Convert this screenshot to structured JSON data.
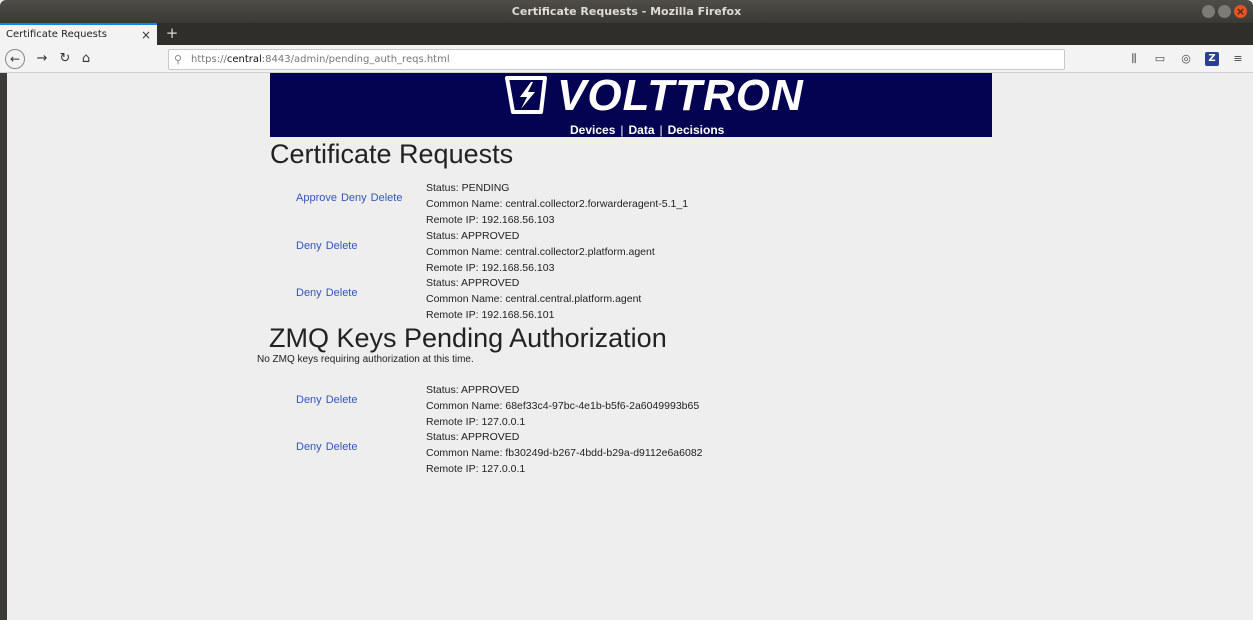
{
  "window": {
    "title": "Certificate Requests - Mozilla Firefox"
  },
  "tabs": [
    {
      "label": "Certificate Requests",
      "active": true
    }
  ],
  "urlbar": {
    "prefix": "https://",
    "host": "central",
    "rest": ":8443/admin/pending_auth_reqs.html"
  },
  "banner": {
    "brand": "VOLTTRON",
    "tm": "™",
    "nav": [
      "Devices",
      "Data",
      "Decisions"
    ],
    "colors": {
      "background": "#040352",
      "text": "#ffffff"
    }
  },
  "cert_section": {
    "heading": "Certificate Requests",
    "requests": [
      {
        "actions": [
          "Approve",
          "Deny",
          "Delete"
        ],
        "status": "Status: PENDING",
        "common_name": "Common Name: central.collector2.forwarderagent-5.1_1",
        "remote_ip": "Remote IP: 192.168.56.103"
      },
      {
        "actions": [
          "Deny",
          "Delete"
        ],
        "status": "Status: APPROVED",
        "common_name": "Common Name: central.collector2.platform.agent",
        "remote_ip": "Remote IP: 192.168.56.103"
      },
      {
        "actions": [
          "Deny",
          "Delete"
        ],
        "status": "Status: APPROVED",
        "common_name": "Common Name: central.central.platform.agent",
        "remote_ip": "Remote IP: 192.168.56.101"
      }
    ]
  },
  "zmq_section": {
    "heading": "ZMQ Keys Pending Authorization",
    "empty_message": "No ZMQ keys requiring authorization at this time.",
    "requests": [
      {
        "actions": [
          "Deny",
          "Delete"
        ],
        "status": "Status: APPROVED",
        "common_name": "Common Name: 68ef33c4-97bc-4e1b-b5f6-2a6049993b65",
        "remote_ip": "Remote IP: 127.0.0.1"
      },
      {
        "actions": [
          "Deny",
          "Delete"
        ],
        "status": "Status: APPROVED",
        "common_name": "Common Name: fb30249d-b267-4bdd-b29a-d9112e6a6082",
        "remote_ip": "Remote IP: 127.0.0.1"
      }
    ]
  },
  "colors": {
    "link": "#3355c0",
    "page_bg": "#eeeeee",
    "tab_accent": "#0a84ff"
  }
}
